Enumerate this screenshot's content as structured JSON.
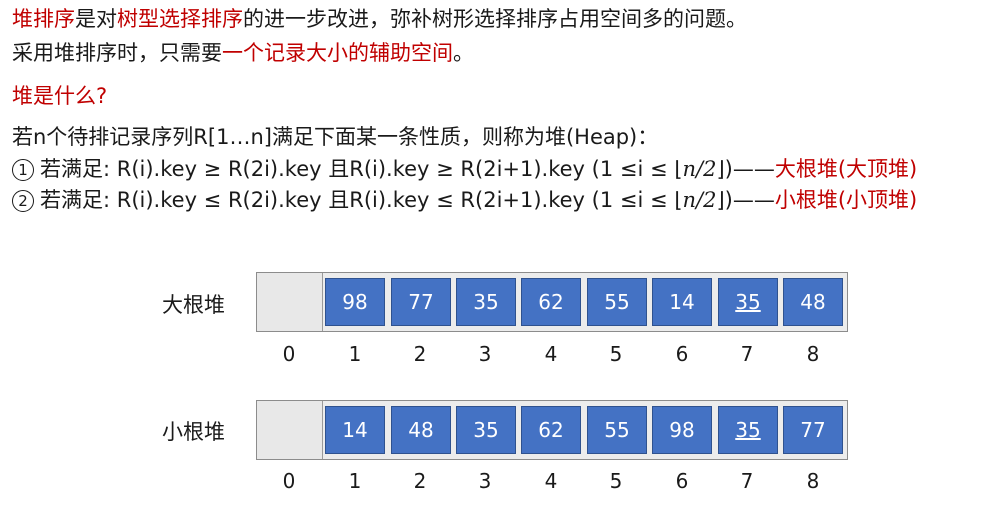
{
  "intro": {
    "l1": {
      "a": "堆排序",
      "b": "是对",
      "c": "树型选择排序",
      "d": "的进一步改进，弥补树形选择排序占用空间多的问题。"
    },
    "l2": {
      "a": "采用堆排序时，只需要",
      "b": "一个记录大小的辅助空间",
      "c": "。"
    },
    "question": "堆是什么?"
  },
  "definition": {
    "text": "若n个待排记录序列R[1…n]满足下面某一条性质，则称为堆(Heap)：",
    "cond1": {
      "num": "1",
      "text": "若满足: R(i).key ≥ R(2i).key 且R(i).key ≥ R(2i+1).key  (1 ≤i ≤ ⌊",
      "math": "n/2",
      "tail": "⌋)——",
      "red": "大根堆(大顶堆)"
    },
    "cond2": {
      "num": "2",
      "text": "若满足: R(i).key ≤ R(2i).key 且R(i).key ≤ R(2i+1).key  (1 ≤i ≤ ⌊",
      "math": "n/2",
      "tail": "⌋)——",
      "red": "小根堆(小顶堆)"
    }
  },
  "max_heap": {
    "label": "大根堆",
    "values": [
      "98",
      "77",
      "35",
      "62",
      "55",
      "14",
      "35",
      "48"
    ],
    "indices": [
      "0",
      "1",
      "2",
      "3",
      "4",
      "5",
      "6",
      "7",
      "8"
    ]
  },
  "min_heap": {
    "label": "小根堆",
    "values": [
      "14",
      "48",
      "35",
      "62",
      "55",
      "98",
      "35",
      "77"
    ],
    "indices": [
      "0",
      "1",
      "2",
      "3",
      "4",
      "5",
      "6",
      "7",
      "8"
    ]
  },
  "colors": {
    "accent_red": "#c00000",
    "cell_blue": "#4472c4"
  }
}
